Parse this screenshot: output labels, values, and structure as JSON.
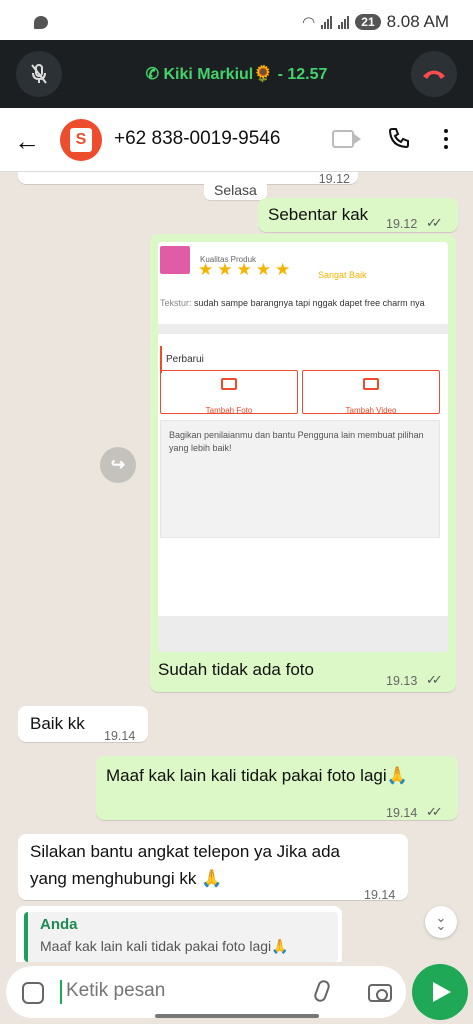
{
  "status_bar": {
    "time": "8.08 AM",
    "battery": "21"
  },
  "call_banner": {
    "label": "Kiki Markiul🌻 - 12.57",
    "accent": "#43d36a",
    "end_color": "#ff4d4d"
  },
  "header": {
    "contact_number": "+62 838-0019-9546",
    "avatar_letter": "S",
    "avatar_color": "#ee4d2d"
  },
  "chat": {
    "top_partial_time": "19.12",
    "day_chip": "Selasa",
    "messages": [
      {
        "from": "me",
        "text": "Sebentar kak",
        "time": "19.12",
        "read": true
      },
      {
        "from": "me",
        "type": "image",
        "caption": "Sudah tidak ada foto",
        "time": "19.13",
        "read": true,
        "image": {
          "product_quality_label": "Kualitas Produk",
          "stars": "★★★★★",
          "rating_text": "Sangat Baik",
          "texture_label": "Tekstur:",
          "texture_text": "sudah sampe barangnya tapi nggak dapet free charm nya",
          "update_label": "Perbarui",
          "add_photo": "Tambah Foto",
          "add_video": "Tambah Video",
          "review_placeholder": "Bagikan penilaianmu dan bantu Pengguna lain membuat pilihan yang lebih baik!"
        }
      },
      {
        "from": "them",
        "text": "Baik kk",
        "time": "19.14"
      },
      {
        "from": "me",
        "text": "Maaf kak lain kali tidak pakai foto lagi🙏",
        "time": "19.14",
        "read": true
      },
      {
        "from": "them",
        "text": "Silakan bantu angkat telepon ya Jika ada yang menghubungi kk 🙏",
        "time": "19.14"
      }
    ],
    "reply_preview": {
      "author": "Anda",
      "text": "Maaf kak lain kali tidak pakai foto lagi🙏"
    }
  },
  "input": {
    "placeholder": "Ketik pesan"
  },
  "colors": {
    "chat_bg": "#ece5dd",
    "outgoing_bubble": "#dcf8c6",
    "incoming_bubble": "#ffffff",
    "send_button": "#1fa855"
  }
}
